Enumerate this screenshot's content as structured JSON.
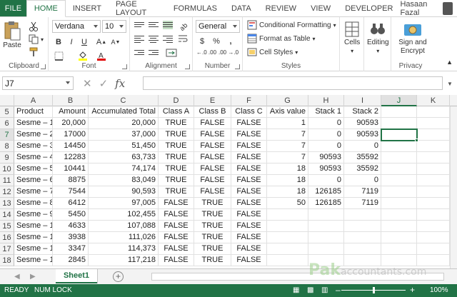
{
  "ribbon_tabs": [
    "FILE",
    "HOME",
    "INSERT",
    "PAGE LAYOUT",
    "FORMULAS",
    "DATA",
    "REVIEW",
    "VIEW",
    "DEVELOPER"
  ],
  "active_tab": "HOME",
  "user_name": "Hasaan Fazal",
  "clipboard": {
    "paste": "Paste",
    "label": "Clipboard"
  },
  "font": {
    "name": "Verdana",
    "size": "10",
    "bold": "B",
    "italic": "I",
    "underline": "U",
    "grow": "A",
    "shrink": "A",
    "label": "Font"
  },
  "alignment": {
    "label": "Alignment"
  },
  "number": {
    "format": "General",
    "currency": "$",
    "percent": "%",
    "comma": ",",
    "inc_dec": "←.0 .00",
    "dec_dec": ".00 →.0",
    "label": "Number"
  },
  "styles": {
    "conditional": "Conditional Formatting",
    "format_table": "Format as Table",
    "cell_styles": "Cell Styles",
    "label": "Styles"
  },
  "cells": {
    "label": "Cells"
  },
  "editing": {
    "label": "Editing"
  },
  "privacy": {
    "sign_line1": "Sign and",
    "sign_line2": "Encrypt",
    "label": "Privacy"
  },
  "name_box": "J7",
  "formula_bar_symbols": {
    "cancel": "✕",
    "enter": "✓",
    "fx": "fx"
  },
  "formula_value": "",
  "columns": [
    "A",
    "B",
    "C",
    "D",
    "E",
    "F",
    "G",
    "H",
    "I",
    "J",
    "K"
  ],
  "selected_column": "J",
  "selected_row": "7",
  "rows": [
    {
      "num": "5",
      "cells": [
        "Product",
        "Amount",
        "Accumulated Total",
        "Class A",
        "Class B",
        "Class C",
        "Axis value",
        "Stack 1",
        "Stack 2",
        "",
        ""
      ]
    },
    {
      "num": "6",
      "cells": [
        "Sesme – 1",
        "20,000",
        "20,000",
        "TRUE",
        "FALSE",
        "FALSE",
        "1",
        "0",
        "90593",
        "",
        ""
      ]
    },
    {
      "num": "7",
      "cells": [
        "Sesme – 2",
        "17000",
        "37,000",
        "TRUE",
        "FALSE",
        "FALSE",
        "7",
        "0",
        "90593",
        "",
        ""
      ]
    },
    {
      "num": "8",
      "cells": [
        "Sesme – 3",
        "14450",
        "51,450",
        "TRUE",
        "FALSE",
        "FALSE",
        "7",
        "0",
        "0",
        "",
        ""
      ]
    },
    {
      "num": "9",
      "cells": [
        "Sesme – 4",
        "12283",
        "63,733",
        "TRUE",
        "FALSE",
        "FALSE",
        "7",
        "90593",
        "35592",
        "",
        ""
      ]
    },
    {
      "num": "10",
      "cells": [
        "Sesme – 5",
        "10441",
        "74,174",
        "TRUE",
        "FALSE",
        "FALSE",
        "18",
        "90593",
        "35592",
        "",
        ""
      ]
    },
    {
      "num": "11",
      "cells": [
        "Sesme – 6",
        "8875",
        "83,049",
        "TRUE",
        "FALSE",
        "FALSE",
        "18",
        "0",
        "0",
        "",
        ""
      ]
    },
    {
      "num": "12",
      "cells": [
        "Sesme – 7",
        "7544",
        "90,593",
        "TRUE",
        "FALSE",
        "FALSE",
        "18",
        "126185",
        "7119",
        "",
        ""
      ]
    },
    {
      "num": "13",
      "cells": [
        "Sesme – 8",
        "6412",
        "97,005",
        "FALSE",
        "TRUE",
        "FALSE",
        "50",
        "126185",
        "7119",
        "",
        ""
      ]
    },
    {
      "num": "14",
      "cells": [
        "Sesme – 9",
        "5450",
        "102,455",
        "FALSE",
        "TRUE",
        "FALSE",
        "",
        "",
        "",
        "",
        ""
      ]
    },
    {
      "num": "15",
      "cells": [
        "Sesme – 1",
        "4633",
        "107,088",
        "FALSE",
        "TRUE",
        "FALSE",
        "",
        "",
        "",
        "",
        ""
      ]
    },
    {
      "num": "16",
      "cells": [
        "Sesme – 1",
        "3938",
        "111,026",
        "FALSE",
        "TRUE",
        "FALSE",
        "",
        "",
        "",
        "",
        ""
      ]
    },
    {
      "num": "17",
      "cells": [
        "Sesme – 1",
        "3347",
        "114,373",
        "FALSE",
        "TRUE",
        "FALSE",
        "",
        "",
        "",
        "",
        ""
      ]
    },
    {
      "num": "18",
      "cells": [
        "Sesme – 1",
        "2845",
        "117,218",
        "FALSE",
        "TRUE",
        "FALSE",
        "",
        "",
        "",
        "",
        ""
      ]
    }
  ],
  "sheet_tab": "Sheet1",
  "add_sheet": "+",
  "status": {
    "ready": "READY",
    "numlock": "NUM LOCK",
    "zoom": "100%",
    "minus": "–",
    "plus": "+"
  },
  "watermark": {
    "main": "Pak",
    "sub": "accountants.com"
  },
  "colors": {
    "accent": "#217346"
  }
}
